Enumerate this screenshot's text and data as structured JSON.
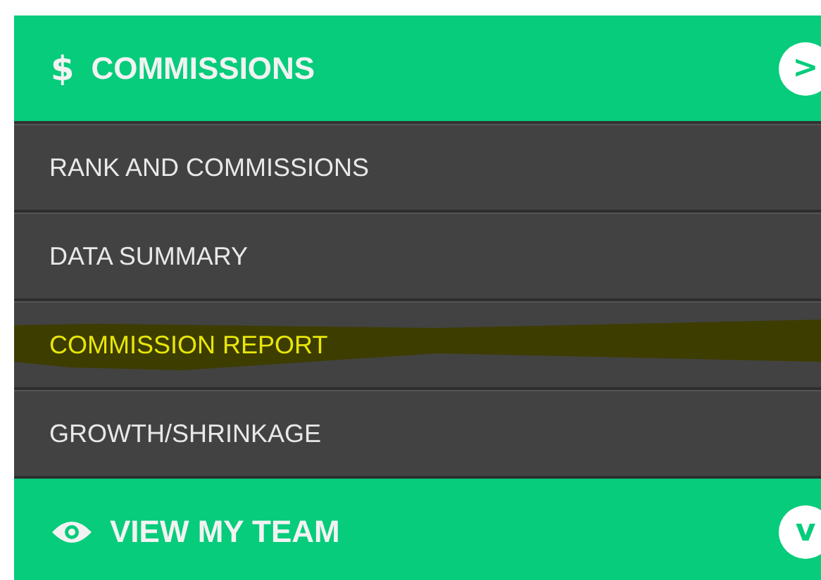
{
  "sections": [
    {
      "kind": "header",
      "symbol": "$",
      "title": "COMMISSIONS",
      "badge": ">"
    },
    {
      "kind": "menu",
      "items": [
        {
          "label": "RANK AND COMMISSIONS",
          "highlighted": false
        },
        {
          "label": "DATA SUMMARY",
          "highlighted": false
        },
        {
          "label": "COMMISSION REPORT",
          "highlighted": true
        },
        {
          "label": "GROWTH/SHRINKAGE",
          "highlighted": false
        }
      ]
    },
    {
      "kind": "header",
      "title": "VIEW MY TEAM",
      "badge": "v"
    }
  ]
}
